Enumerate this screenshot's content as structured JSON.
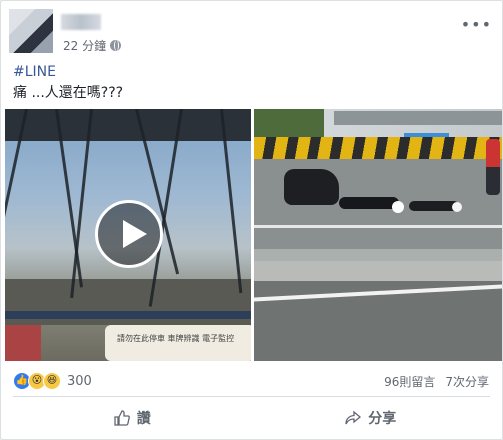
{
  "post": {
    "time": "22 分鐘",
    "hashtag": "#LINE",
    "text": "痛 ...人還在嗎???",
    "video_caption": "請勿在此停車 車牌辨識 電子監控"
  },
  "footer": {
    "reaction_count": "300",
    "comments": "96則留言",
    "shares": "7次分享"
  },
  "actions": {
    "like_label": "讚",
    "share_label": "分享"
  },
  "colors": {
    "link": "#385898",
    "like_blue": "#2e7bf6",
    "wow_yellow": "#f7c844"
  }
}
